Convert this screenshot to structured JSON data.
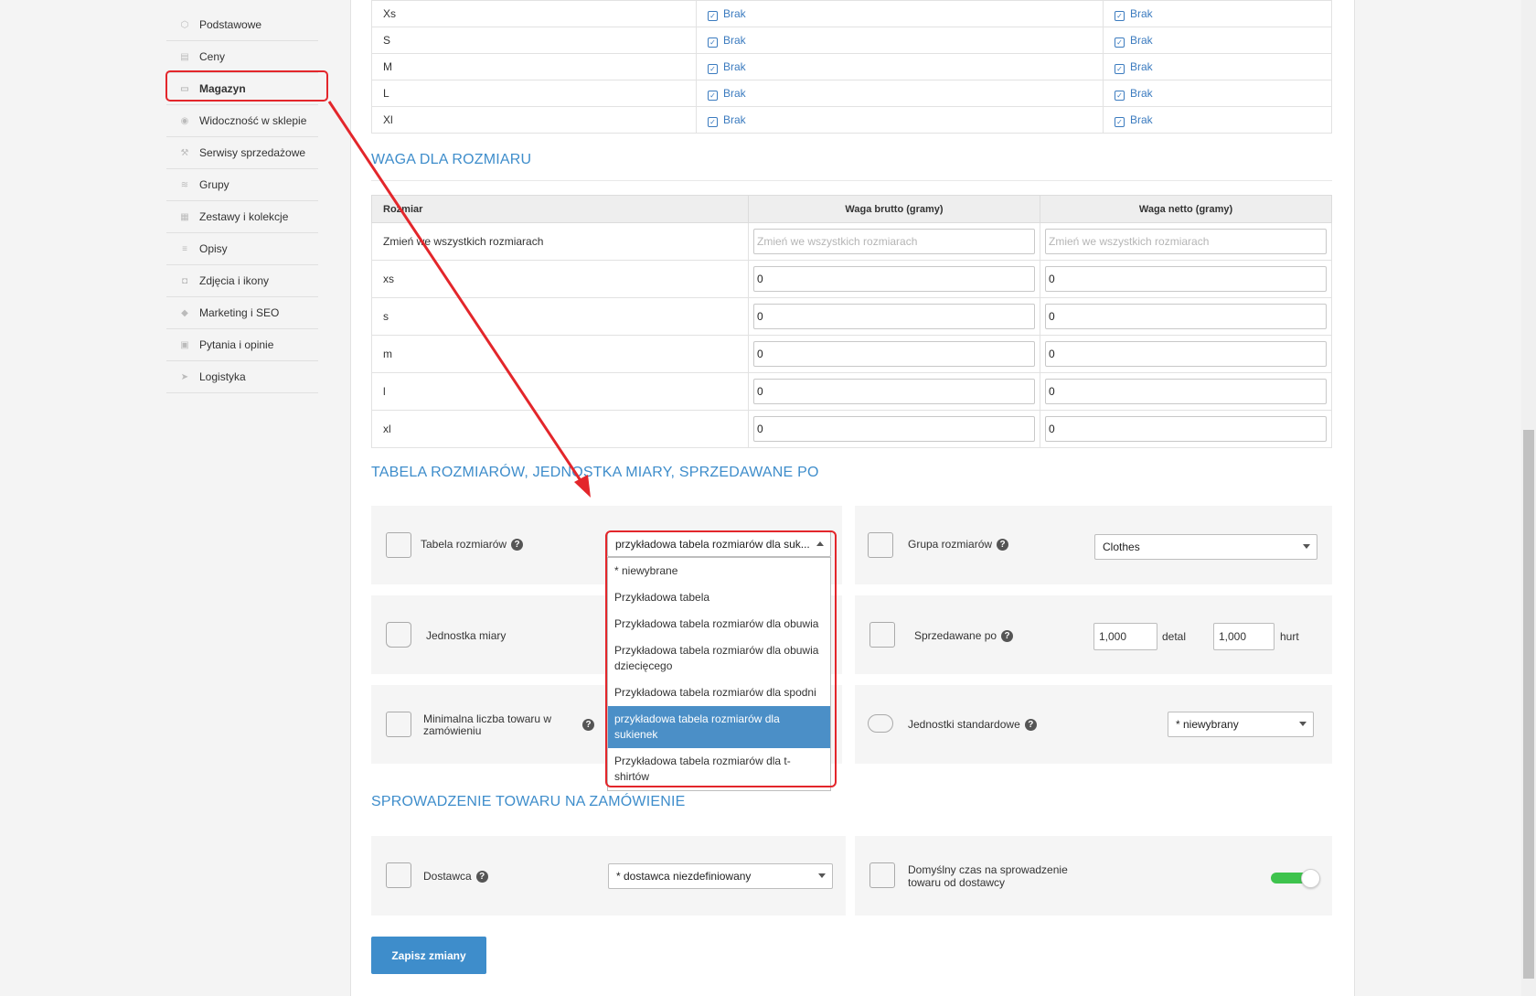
{
  "sidebar": {
    "items": [
      {
        "label": "Podstawowe",
        "icon": "cube-icon"
      },
      {
        "label": "Ceny",
        "icon": "price-icon"
      },
      {
        "label": "Magazyn",
        "icon": "warehouse-icon"
      },
      {
        "label": "Widoczność w sklepie",
        "icon": "eye-icon"
      },
      {
        "label": "Serwisy sprzedażowe",
        "icon": "hammer-icon"
      },
      {
        "label": "Grupy",
        "icon": "layers-icon"
      },
      {
        "label": "Zestawy i kolekcje",
        "icon": "collection-icon"
      },
      {
        "label": "Opisy",
        "icon": "text-icon"
      },
      {
        "label": "Zdjęcia i ikony",
        "icon": "camera-icon"
      },
      {
        "label": "Marketing i SEO",
        "icon": "tag-icon"
      },
      {
        "label": "Pytania i opinie",
        "icon": "chat-icon"
      },
      {
        "label": "Logistyka",
        "icon": "send-icon"
      }
    ],
    "active": "Magazyn"
  },
  "availability": {
    "rows": [
      {
        "size": "Xs",
        "col1": "Brak",
        "col2": "Brak"
      },
      {
        "size": "S",
        "col1": "Brak",
        "col2": "Brak"
      },
      {
        "size": "M",
        "col1": "Brak",
        "col2": "Brak"
      },
      {
        "size": "L",
        "col1": "Brak",
        "col2": "Brak"
      },
      {
        "size": "Xl",
        "col1": "Brak",
        "col2": "Brak"
      }
    ]
  },
  "weight": {
    "title": "WAGA DLA ROZMIARU",
    "headers": {
      "size": "Rozmiar",
      "gross": "Waga brutto (gramy)",
      "net": "Waga netto (gramy)"
    },
    "all_label": "Zmień we wszystkich rozmiarach",
    "all_placeholder": "Zmień we wszystkich rozmiarach",
    "rows": [
      {
        "size": "xs",
        "gross": "0",
        "net": "0"
      },
      {
        "size": "s",
        "gross": "0",
        "net": "0"
      },
      {
        "size": "m",
        "gross": "0",
        "net": "0"
      },
      {
        "size": "l",
        "gross": "0",
        "net": "0"
      },
      {
        "size": "xl",
        "gross": "0",
        "net": "0"
      }
    ]
  },
  "size_table_section": {
    "title": "TABELA ROZMIARÓW, JEDNOSTKA MIARY, SPRZEDAWANE PO",
    "size_table_label": "Tabela rozmiarów",
    "size_table_value": "przykładowa tabela rozmiarów dla suk...",
    "dropdown_options": [
      "* niewybrane",
      "Przykładowa tabela",
      "Przykładowa tabela rozmiarów dla obuwia",
      "Przykładowa tabela rozmiarów dla obuwia dziecięcego",
      "Przykładowa tabela rozmiarów dla spodni",
      "przykładowa tabela rozmiarów dla sukienek",
      "Przykładowa tabela rozmiarów dla t-shirtów"
    ],
    "selected_option_index": 5,
    "size_group_label": "Grupa rozmiarów",
    "size_group_value": "Clothes",
    "unit_label": "Jednostka miary",
    "sold_by_label": "Sprzedawane po",
    "retail_value": "1,000",
    "retail_label": "detal",
    "wholesale_value": "1,000",
    "wholesale_label": "hurt",
    "min_qty_label": "Minimalna liczba towaru w zamówieniu",
    "std_units_label": "Jednostki standardowe",
    "std_units_value": "* niewybrany"
  },
  "import_section": {
    "title": "SPROWADZENIE TOWARU NA ZAMÓWIENIE",
    "supplier_label": "Dostawca",
    "supplier_value": "* dostawca niezdefiniowany",
    "default_time_label": "Domyślny czas na sprowadzenie towaru od dostawcy",
    "toggle_on": true
  },
  "save_button": "Zapisz zmiany",
  "colors": {
    "accent": "#3e8dcb",
    "highlight": "#e3262b",
    "toggle": "#3ec34d"
  }
}
